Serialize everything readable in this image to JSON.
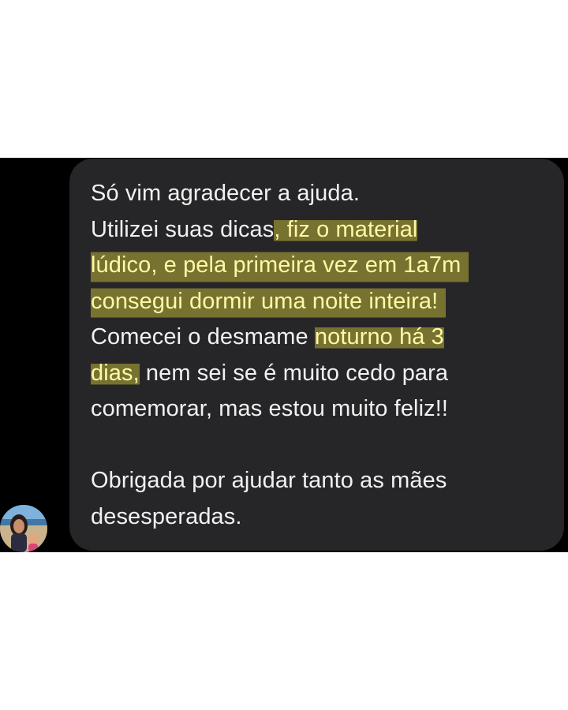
{
  "message": {
    "lines": [
      {
        "segments": [
          {
            "text": "Só vim agradecer a ajuda.",
            "highlight": false
          }
        ]
      },
      {
        "segments": [
          {
            "text": "Utilizei suas dicas",
            "highlight": false
          },
          {
            "text": ", fiz o material",
            "highlight": true
          }
        ]
      },
      {
        "segments": [
          {
            "text": "lúdico, e pela primeira vez em 1a7m",
            "highlight": true
          }
        ]
      },
      {
        "segments": [
          {
            "text": "consegui dormir uma noite inteira!",
            "highlight": true
          }
        ]
      },
      {
        "segments": [
          {
            "text": "Comecei o desmame ",
            "highlight": false
          },
          {
            "text": "noturno há 3",
            "highlight": true
          }
        ]
      },
      {
        "segments": [
          {
            "text": "dias,",
            "highlight": true
          },
          {
            "text": " nem sei se é muito cedo para",
            "highlight": false
          }
        ]
      },
      {
        "segments": [
          {
            "text": "comemorar, mas estou muito feliz!!",
            "highlight": false
          }
        ]
      },
      {
        "segments": []
      },
      {
        "segments": [
          {
            "text": "Obrigada por ajudar tanto as mães",
            "highlight": false
          }
        ]
      },
      {
        "segments": [
          {
            "text": "desesperadas.",
            "highlight": false
          }
        ]
      }
    ]
  },
  "colors": {
    "page_background": "#ffffff",
    "chat_background": "#000000",
    "bubble_background": "#262628",
    "message_text": "#f1f1f1",
    "highlight_marker": "#f0e43c"
  },
  "avatar": {
    "icon": "profile-photo-icon"
  }
}
